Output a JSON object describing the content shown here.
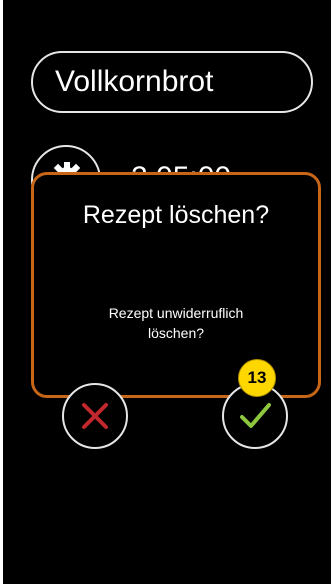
{
  "recipe": {
    "name": "Vollkornbrot",
    "background_row_text": "2    05:00"
  },
  "dialog": {
    "title": "Rezept löschen?",
    "message_line1": "Rezept unwiderruflich",
    "message_line2": "löschen?"
  },
  "actions": {
    "cancel_icon": "x-icon",
    "confirm_icon": "check-icon"
  },
  "annotation": {
    "step_number": "13"
  },
  "colors": {
    "dialog_border": "#c76617",
    "cancel_icon": "#c0282d",
    "confirm_icon": "#8dc63f",
    "badge": "#ffd700"
  }
}
